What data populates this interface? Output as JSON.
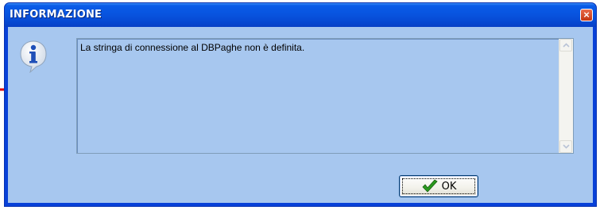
{
  "dialog": {
    "title": "INFORMAZIONE",
    "close_glyph": "×",
    "message": "La stringa di connessione al DBPaghe non è definita.",
    "icons": {
      "dialog_icon": "info-icon",
      "ok_icon": "checkmark-icon",
      "close_icon": "close-icon",
      "annotation": "red-arrow-icon"
    },
    "buttons": {
      "ok_label": "OK"
    }
  },
  "colors": {
    "titlebar": "#0853de",
    "client_background": "#a7c7ef",
    "close_button": "#c33613",
    "annotation_arrow": "#e00000",
    "check_green": "#2a9a1f"
  }
}
